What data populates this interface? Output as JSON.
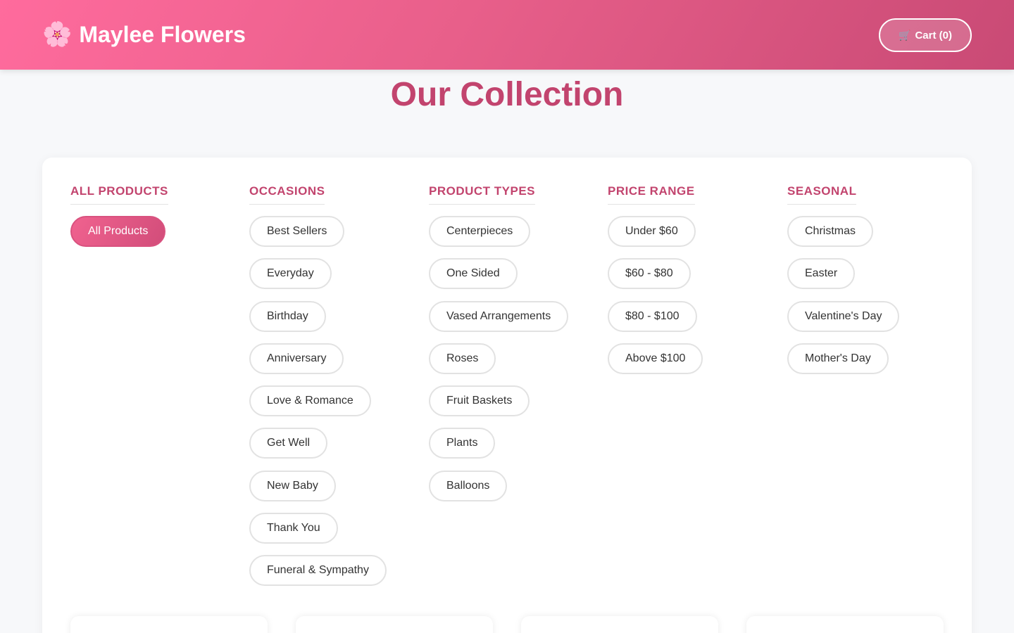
{
  "header": {
    "brand_icon": "cherry-blossom-icon",
    "brand_icon_glyph": "🌸",
    "brand_name": "Maylee Flowers",
    "cart_icon": "🛒",
    "cart_label": "Cart (0)"
  },
  "page": {
    "title": "Our Collection"
  },
  "colors": {
    "brand_pink": "#ff6b9d",
    "brand_dark": "#c2446e",
    "background": "#f7f8fa"
  },
  "filters": {
    "all": {
      "title": "ALL PRODUCTS",
      "items": [
        "All Products"
      ],
      "active": "All Products"
    },
    "occasions": {
      "title": "OCCASIONS",
      "items": [
        "Best Sellers",
        "Everyday",
        "Birthday",
        "Anniversary",
        "Love & Romance",
        "Get Well",
        "New Baby",
        "Thank You",
        "Funeral & Sympathy"
      ]
    },
    "product_types": {
      "title": "PRODUCT TYPES",
      "items": [
        "Centerpieces",
        "One Sided",
        "Vased Arrangements",
        "Roses",
        "Fruit Baskets",
        "Plants",
        "Balloons"
      ]
    },
    "price_range": {
      "title": "PRICE RANGE",
      "items": [
        "Under $60",
        "$60 - $80",
        "$80 - $100",
        "Above $100"
      ]
    },
    "seasonal": {
      "title": "SEASONAL",
      "items": [
        "Christmas",
        "Easter",
        "Valentine's Day",
        "Mother's Day"
      ]
    }
  }
}
